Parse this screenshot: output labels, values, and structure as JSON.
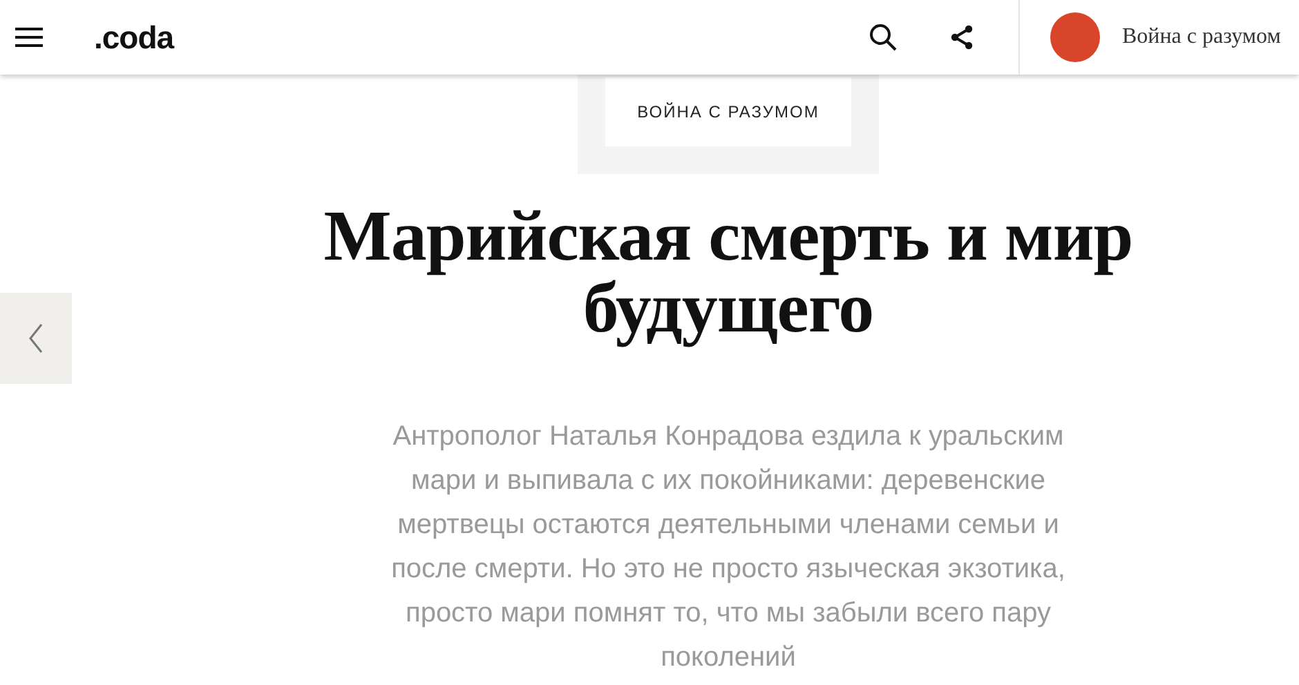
{
  "header": {
    "logo": ".coda",
    "series_title": "Война с разумом"
  },
  "series_label": "ВОЙНА С РАЗУМОМ",
  "article": {
    "title": "Марийская смерть и мир будущего",
    "lede": "Антрополог Наталья Конрадова ездила к уральским мари и выпивала с их покойниками: деревенские мертвецы остаются деятельными членами семьи и после смерти. Но это не просто языческая экзотика, просто мари помнят то, что мы забыли всего пару поколений"
  }
}
